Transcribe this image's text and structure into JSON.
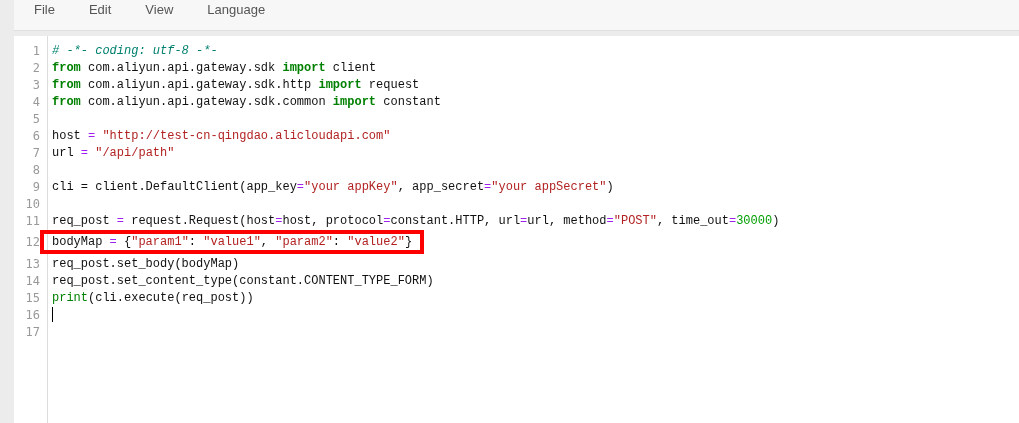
{
  "menu": [
    "File",
    "Edit",
    "View",
    "Language"
  ],
  "editor": {
    "lines": [
      {
        "number": "1",
        "tokens": [
          {
            "kind": "comment",
            "text": "# -*- coding: utf-8 -*-"
          }
        ]
      },
      {
        "number": "2",
        "tokens": [
          {
            "kind": "keyword",
            "text": "from"
          },
          {
            "kind": "plain",
            "text": " com.aliyun.api.gateway.sdk "
          },
          {
            "kind": "keyword",
            "text": "import"
          },
          {
            "kind": "plain",
            "text": " client"
          }
        ]
      },
      {
        "number": "3",
        "tokens": [
          {
            "kind": "keyword",
            "text": "from"
          },
          {
            "kind": "plain",
            "text": " com.aliyun.api.gateway.sdk.http "
          },
          {
            "kind": "keyword",
            "text": "import"
          },
          {
            "kind": "plain",
            "text": " request"
          }
        ]
      },
      {
        "number": "4",
        "tokens": [
          {
            "kind": "keyword",
            "text": "from"
          },
          {
            "kind": "plain",
            "text": " com.aliyun.api.gateway.sdk.common "
          },
          {
            "kind": "keyword",
            "text": "import"
          },
          {
            "kind": "plain",
            "text": " constant"
          }
        ]
      },
      {
        "number": "5"
      },
      {
        "number": "6",
        "tokens": [
          {
            "kind": "plain",
            "text": "host "
          },
          {
            "kind": "operator",
            "text": "="
          },
          {
            "kind": "string",
            "text": " \"http://test-cn-qingdao.alicloudapi.com\""
          }
        ]
      },
      {
        "number": "7",
        "tokens": [
          {
            "kind": "plain",
            "text": "url "
          },
          {
            "kind": "operator",
            "text": "="
          },
          {
            "kind": "string",
            "text": " \"/api/path\""
          }
        ]
      },
      {
        "number": "8"
      },
      {
        "number": "9",
        "tokens": [
          {
            "kind": "plain",
            "text": "cli = client.DefaultClient(app_key"
          },
          {
            "kind": "operator",
            "text": "="
          },
          {
            "kind": "string",
            "text": "\"your appKey\""
          },
          {
            "kind": "plain",
            "text": ", app_secret"
          },
          {
            "kind": "operator",
            "text": "="
          },
          {
            "kind": "string",
            "text": "\"your appSecret\""
          },
          {
            "kind": "plain",
            "text": ")"
          }
        ]
      },
      {
        "number": "10"
      },
      {
        "number": "11",
        "tokens": [
          {
            "kind": "plain",
            "text": "req_post "
          },
          {
            "kind": "operator",
            "text": "="
          },
          {
            "kind": "plain",
            "text": " request.Request(host"
          },
          {
            "kind": "operator",
            "text": "="
          },
          {
            "kind": "plain",
            "text": "host, protocol"
          },
          {
            "kind": "operator",
            "text": "="
          },
          {
            "kind": "plain",
            "text": "constant.HTTP, url"
          },
          {
            "kind": "operator",
            "text": "="
          },
          {
            "kind": "plain",
            "text": "url, method"
          },
          {
            "kind": "operator",
            "text": "="
          },
          {
            "kind": "string",
            "text": "\"POST\""
          },
          {
            "kind": "plain",
            "text": ", time_out"
          },
          {
            "kind": "operator",
            "text": "="
          },
          {
            "kind": "number",
            "text": "30000"
          },
          {
            "kind": "plain",
            "text": ")"
          }
        ]
      },
      {
        "number": "12",
        "highlighted": true,
        "tokens": [
          {
            "kind": "plain",
            "text": "bodyMap "
          },
          {
            "kind": "operator",
            "text": "="
          },
          {
            "kind": "plain",
            "text": " {"
          },
          {
            "kind": "string",
            "text": "\"param1\""
          },
          {
            "kind": "plain",
            "text": ": "
          },
          {
            "kind": "string",
            "text": "\"value1\""
          },
          {
            "kind": "plain",
            "text": ", "
          },
          {
            "kind": "string",
            "text": "\"param2\""
          },
          {
            "kind": "plain",
            "text": ": "
          },
          {
            "kind": "string",
            "text": "\"value2\""
          },
          {
            "kind": "plain",
            "text": "}"
          }
        ]
      },
      {
        "number": "13",
        "tokens": [
          {
            "kind": "plain",
            "text": "req_post.set_body(bodyMap)"
          }
        ]
      },
      {
        "number": "14",
        "tokens": [
          {
            "kind": "plain",
            "text": "req_post.set_content_type(constant.CONTENT_TYPE_FORM)"
          }
        ]
      },
      {
        "number": "15",
        "tokens": [
          {
            "kind": "builtin",
            "text": "print"
          },
          {
            "kind": "plain",
            "text": "(cli.execute(req_post))"
          }
        ]
      },
      {
        "number": "16",
        "cursor": true
      },
      {
        "number": "17"
      }
    ]
  }
}
